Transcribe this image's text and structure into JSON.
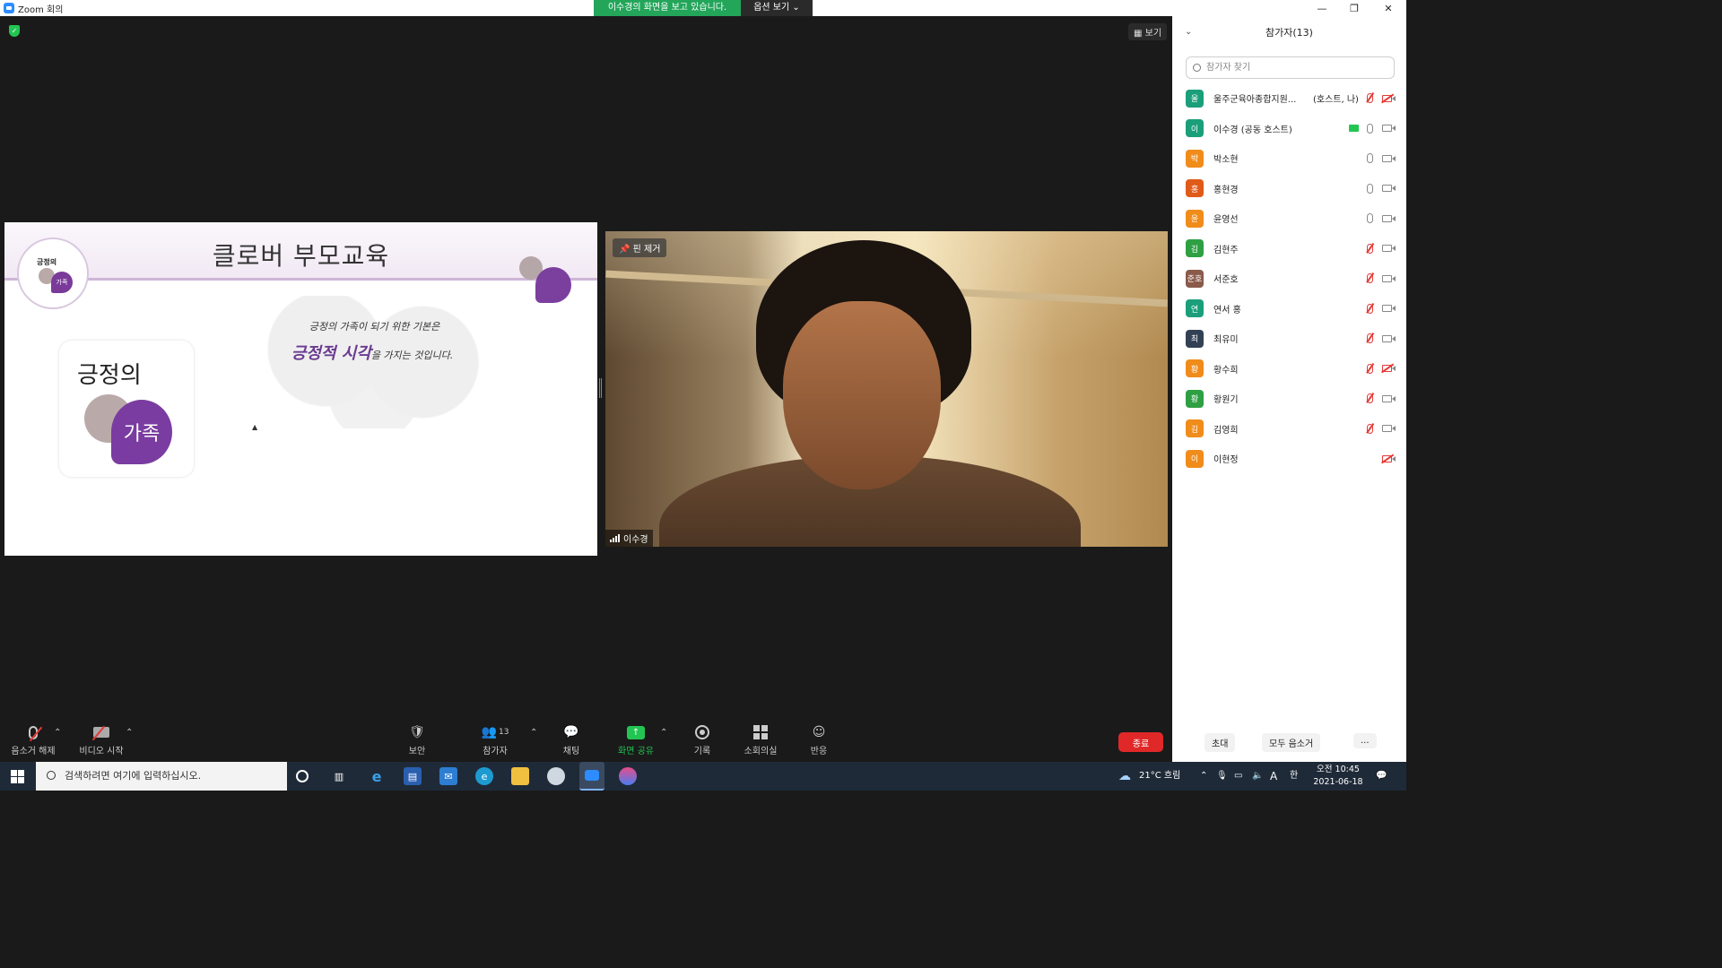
{
  "window": {
    "title": "Zoom 회의",
    "minimize": "—",
    "restore": "❐",
    "close": "✕"
  },
  "share_banner": {
    "status": "이수경의 화면을 보고 있습니다.",
    "options": "옵션 보기 ⌄"
  },
  "meeting": {
    "view_button": "▦ 보기",
    "slide": {
      "title": "클로버 부모교육",
      "logo_small_text": "긍정의",
      "logo_small_family": "가족",
      "line1": "긍정의 가족이 되기 위한 기본은",
      "line2_highlight": "긍정적 시각",
      "line2_rest": "을 가지는 것입니다.",
      "card_text": "긍정의",
      "card_family": "가족"
    },
    "video": {
      "pin_label": "핀 제거",
      "name": "이수경"
    }
  },
  "toolbar": {
    "unmute": "음소거 해제",
    "start_video": "비디오 시작",
    "security": "보안",
    "participants": "참가자",
    "participants_count": "13",
    "chat": "채팅",
    "share_screen": "화면 공유",
    "record": "기록",
    "breakout": "소회의실",
    "reactions": "반응",
    "end": "종료"
  },
  "participants_panel": {
    "title": "참가자(13)",
    "search_placeholder": "참가자 찾기",
    "items": [
      {
        "avatar": "울",
        "color": "#1a9f7a",
        "name": "울주군육아종합지원...",
        "tag": "(호스트, 나)",
        "mic": "off",
        "cam": "off",
        "sharing": false
      },
      {
        "avatar": "이",
        "color": "#1a9f7a",
        "name": "이수경 (공동 호스트)",
        "tag": "",
        "mic": "on",
        "cam": "on",
        "sharing": true
      },
      {
        "avatar": "박",
        "color": "#f08c1a",
        "name": "박소현",
        "tag": "",
        "mic": "on",
        "cam": "on",
        "sharing": false
      },
      {
        "avatar": "홍",
        "color": "#e05a1a",
        "name": "홍현경",
        "tag": "",
        "mic": "on",
        "cam": "on",
        "sharing": false
      },
      {
        "avatar": "윤",
        "color": "#f08c1a",
        "name": "윤영선",
        "tag": "",
        "mic": "on",
        "cam": "on",
        "sharing": false
      },
      {
        "avatar": "김",
        "color": "#2ea043",
        "name": "김현주",
        "tag": "",
        "mic": "off",
        "cam": "on",
        "sharing": false
      },
      {
        "avatar": "준호",
        "color": "#8a5a4a",
        "name": "서준호",
        "tag": "",
        "mic": "off",
        "cam": "on",
        "sharing": false
      },
      {
        "avatar": "연",
        "color": "#1a9f7a",
        "name": "연서 홍",
        "tag": "",
        "mic": "off",
        "cam": "on",
        "sharing": false
      },
      {
        "avatar": "최",
        "color": "#334155",
        "name": "최유미",
        "tag": "",
        "mic": "off",
        "cam": "on",
        "sharing": false
      },
      {
        "avatar": "황",
        "color": "#f08c1a",
        "name": "황수희",
        "tag": "",
        "mic": "off",
        "cam": "off",
        "sharing": false
      },
      {
        "avatar": "황",
        "color": "#2ea043",
        "name": "황원기",
        "tag": "",
        "mic": "off",
        "cam": "on",
        "sharing": false
      },
      {
        "avatar": "김",
        "color": "#f08c1a",
        "name": "김영희",
        "tag": "",
        "mic": "off",
        "cam": "on",
        "sharing": false
      },
      {
        "avatar": "이",
        "color": "#f08c1a",
        "name": "이현정",
        "tag": "",
        "mic": "none",
        "cam": "off",
        "sharing": false
      }
    ],
    "invite": "초대",
    "mute_all": "모두 음소거",
    "more": "..."
  },
  "taskbar": {
    "search_placeholder": "검색하려면 여기에 입력하십시오.",
    "weather": "21°C 흐림",
    "time": "오전 10:45",
    "date": "2021-06-18",
    "ime": "A",
    "lang": "한"
  },
  "colors": {
    "zoom_blue": "#2d8cff",
    "share_green": "#23a55a",
    "end_red": "#e02828",
    "slide_purple": "#6a3a90"
  }
}
